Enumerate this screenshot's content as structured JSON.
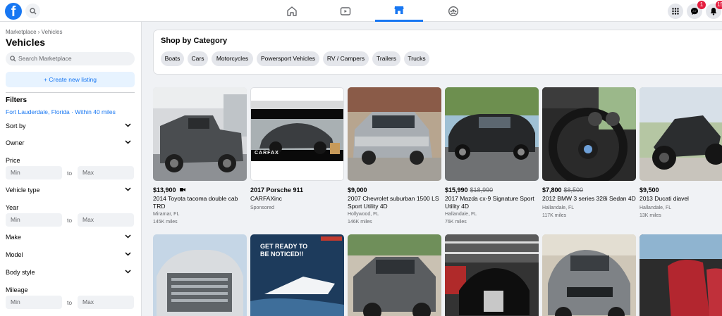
{
  "topbar": {
    "logo_letter": "f",
    "messenger_badge": "1",
    "notifications_badge": "15"
  },
  "sidebar": {
    "breadcrumb": "Marketplace › Vehicles",
    "title": "Vehicles",
    "search_placeholder": "Search Marketplace",
    "create_label": "+ Create new listing",
    "filters_heading": "Filters",
    "location": "Fort Lauderdale, Florida · Within 40 miles",
    "sort_by": "Sort by",
    "owner": "Owner",
    "price": "Price",
    "price_min": "Min",
    "price_to": "to",
    "price_max": "Max",
    "vehicle_type": "Vehicle type",
    "year": "Year",
    "year_min": "Min",
    "year_to": "to",
    "year_max": "Max",
    "make": "Make",
    "model": "Model",
    "body_style": "Body style",
    "mileage": "Mileage",
    "mileage_min": "Min",
    "mileage_to": "to",
    "mileage_max": "Max"
  },
  "categories": {
    "title": "Shop by Category",
    "items": [
      "Boats",
      "Cars",
      "Motorcycles",
      "Powersport Vehicles",
      "RV / Campers",
      "Trailers",
      "Trucks"
    ]
  },
  "listings": [
    {
      "price": "$13,900",
      "old_price": "",
      "title": "2014 Toyota tacoma double cab TRD",
      "location": "Miramar, FL",
      "miles": "145K miles"
    },
    {
      "price": "2017 Porsche 911",
      "old_price": "",
      "title": "CARFAXinc",
      "location": "Sponsored",
      "miles": "",
      "overlay": "CARFAX"
    },
    {
      "price": "$9,000",
      "old_price": "",
      "title": "2007 Chevrolet suburban 1500 LS Sport Utility 4D",
      "location": "Hollywood, FL",
      "miles": "146K miles"
    },
    {
      "price": "$15,990",
      "old_price": "$18,990",
      "title": "2017 Mazda cx-9 Signature Sport Utility 4D",
      "location": "Hallandale, FL",
      "miles": "76K miles"
    },
    {
      "price": "$7,800",
      "old_price": "$8,500",
      "title": "2012 BMW 3 series 328i Sedan 4D",
      "location": "Hallandale, FL",
      "miles": "117K miles"
    },
    {
      "price": "$9,500",
      "old_price": "",
      "title": "2013 Ducati diavel",
      "location": "Hallandale, FL",
      "miles": "13K miles"
    }
  ],
  "row2": {
    "ad_text": "GET READY TO BE NOTICED!!"
  }
}
